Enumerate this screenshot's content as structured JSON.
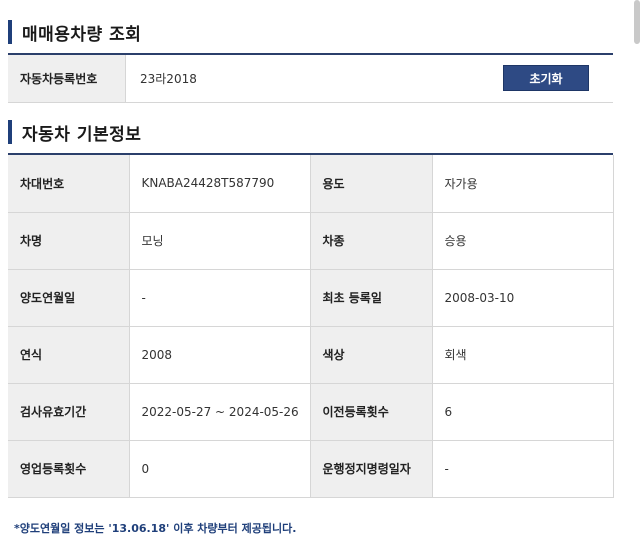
{
  "lookup_section": {
    "title": "매매용차량 조회",
    "field_label": "자동차등록번호",
    "field_value": "23라2018",
    "reset_button": "초기화"
  },
  "basic_info_section": {
    "title": "자동차 기본정보",
    "rows": [
      [
        {
          "label": "차대번호",
          "value": "KNABA24428T587790"
        },
        {
          "label": "용도",
          "value": "자가용"
        }
      ],
      [
        {
          "label": "차명",
          "value": "모닝"
        },
        {
          "label": "차종",
          "value": "승용"
        }
      ],
      [
        {
          "label": "양도연월일",
          "value": "-"
        },
        {
          "label": "최초 등록일",
          "value": "2008-03-10"
        }
      ],
      [
        {
          "label": "연식",
          "value": "2008"
        },
        {
          "label": "색상",
          "value": "회색"
        }
      ],
      [
        {
          "label": "검사유효기간",
          "value": "2022-05-27 ~ 2024-05-26"
        },
        {
          "label": "이전등록횟수",
          "value": "6"
        }
      ],
      [
        {
          "label": "영업등록횟수",
          "value": "0"
        },
        {
          "label": "운행정지명령일자",
          "value": "-"
        }
      ]
    ]
  },
  "footnote": "*양도연월일 정보는 '13.06.18' 이후 차량부터 제공됩니다.",
  "colors": {
    "accent": "#1f3f7a",
    "button": "#2e4a84",
    "header_cell": "#efefef"
  }
}
